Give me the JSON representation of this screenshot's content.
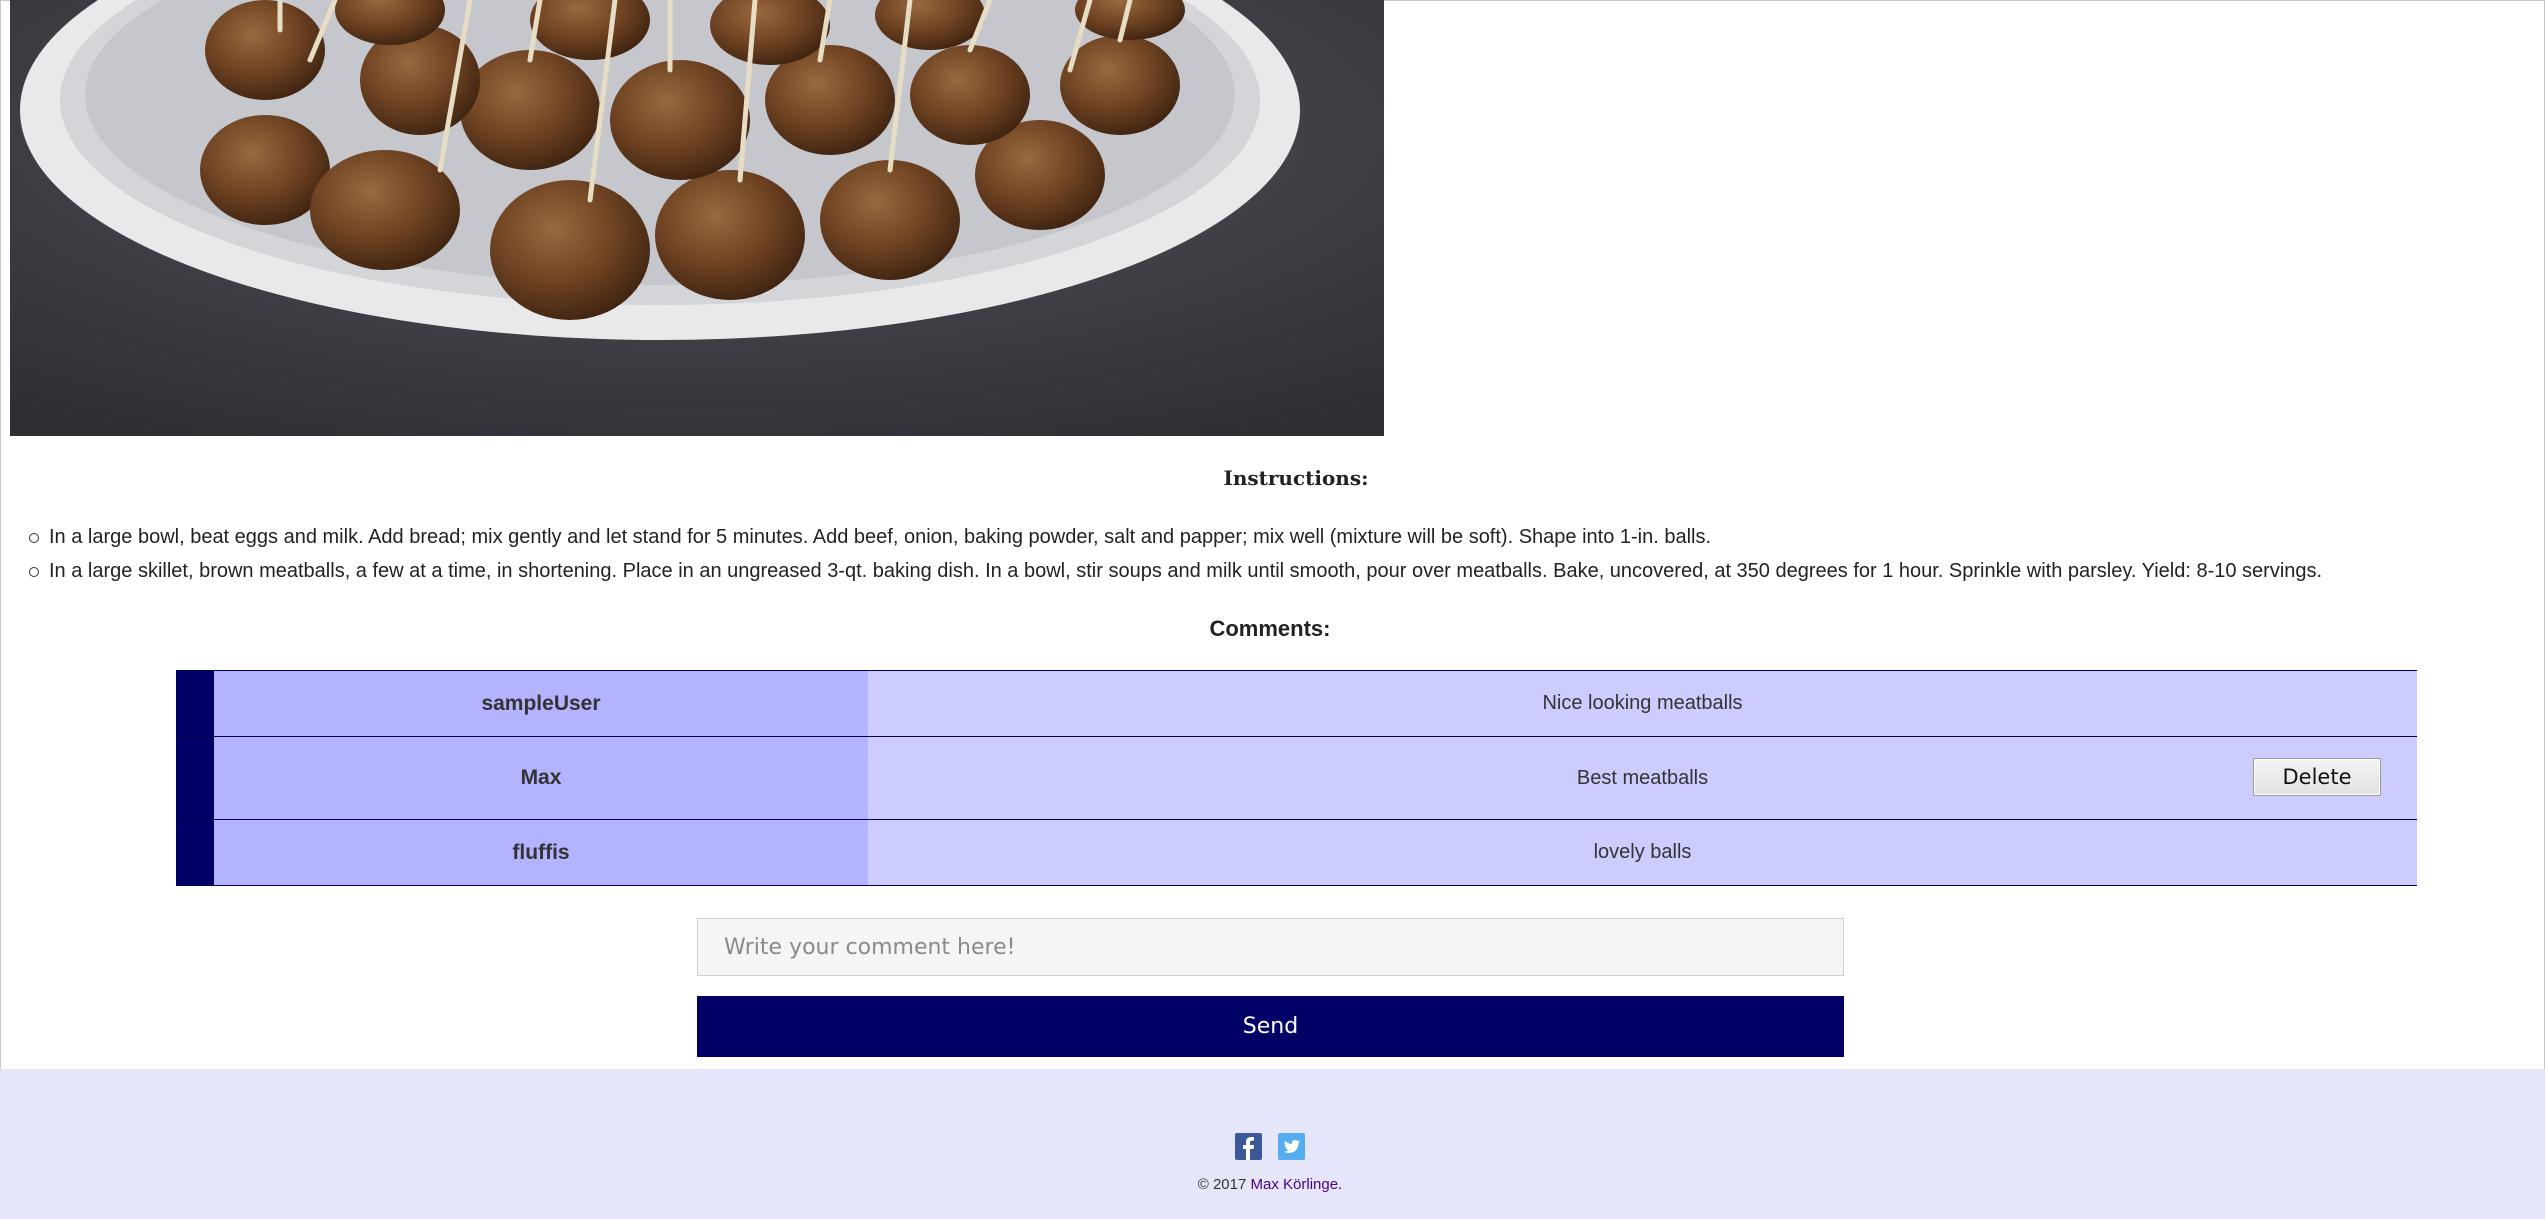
{
  "hero": {
    "image_label": "Plate of meatballs on toothpicks"
  },
  "instructions": {
    "title": "Instructions:",
    "steps": [
      "In a large bowl, beat eggs and milk. Add bread; mix gently and let stand for 5 minutes. Add beef, onion, baking powder, salt and papper; mix well (mixture will be soft). Shape into 1-in. balls.",
      "In a large skillet, brown meatballs, a few at a time, in shortening. Place in an ungreased 3-qt. baking dish. In a bowl, stir soups and milk until smooth, pour over meatballs. Bake, uncovered, at 350 degrees for 1 hour. Sprinkle with parsley. Yield: 8-10 servings."
    ]
  },
  "comments": {
    "title": "Comments:",
    "rows": [
      {
        "user": "sampleUser",
        "text": "Nice looking meatballs"
      },
      {
        "user": "Max",
        "text": "Best meatballs",
        "action": "Delete"
      },
      {
        "user": "fluffis",
        "text": "lovely balls"
      }
    ]
  },
  "comment_form": {
    "placeholder": "Write your comment here!",
    "value": "",
    "send_label": "Send"
  },
  "footer": {
    "social": [
      "facebook-icon",
      "twitter-icon"
    ],
    "copyright_prefix": "© 2017 ",
    "author": "Max Körlinge."
  },
  "colors": {
    "navy": "#000066",
    "user_cell": "#b3b3ff",
    "text_cell": "#ccccff",
    "footer_bg": "#e6e6fa"
  }
}
